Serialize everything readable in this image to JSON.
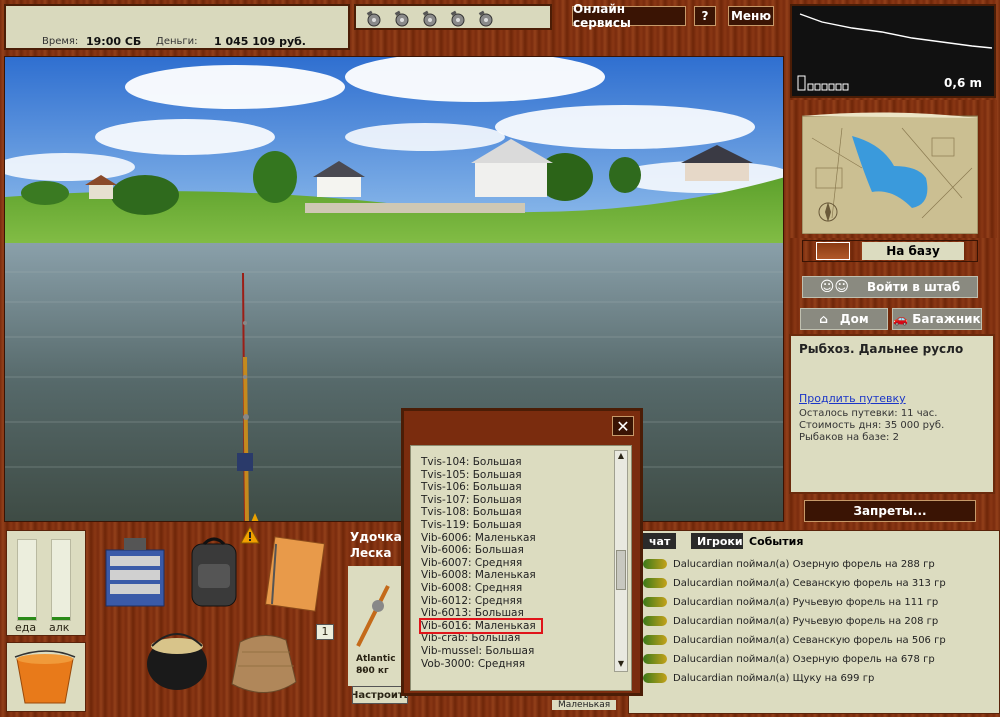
{
  "hud": {
    "time_label": "Время:",
    "time_value": "19:00 СБ",
    "money_label": "Деньги:",
    "money_value": "1 045 109 руб."
  },
  "menu": {
    "online_services": "Онлайн сервисы",
    "help": "?",
    "menu": "Меню"
  },
  "depth": {
    "value": "0,6 m"
  },
  "nav": {
    "to_base": "На базу",
    "hq": "Войти в штаб",
    "home": "Дом",
    "trunk": "Багажник",
    "bans": "Запреты..."
  },
  "base": {
    "title": "Рыбхоз. Дальнее русло",
    "extend_link": "Продлить путевку",
    "remaining": "Осталось путевки: 11 час.",
    "cost": "Стоимость дня: 35 000 руб.",
    "fishers": "Рыбаков на базе: 2"
  },
  "meters": {
    "food_label": "еда",
    "alc_label": "алк",
    "food_level": 0.04,
    "alc_level": 0.04
  },
  "inventory": {
    "slot_count": "1"
  },
  "rod": {
    "rod_label": "Удочка",
    "line_label": "Леска",
    "reel_name": "Atlantic ...",
    "reel_weight": "800 кг",
    "setup_button": "Настроить",
    "size_hint": "Маленькая"
  },
  "events": {
    "tabs": [
      "чат",
      "Игроки",
      "События"
    ],
    "active_tab": "События",
    "rows": [
      "Dalucardian поймал(а) Озерную форель на 288 гр",
      "Dalucardian поймал(а) Севанскую форель на 313 гр",
      "Dalucardian поймал(а) Ручьевую форель на 111 гр",
      "Dalucardian поймал(а) Ручьевую форель на 208 гр",
      "Dalucardian поймал(а) Севанскую форель на 506 гр",
      "Dalucardian поймал(а) Озерную форель на 678 гр",
      "Dalucardian поймал(а) Щуку на 699 гр"
    ]
  },
  "lure_list": {
    "close": "✕",
    "items": [
      "Tvis-104: Большая",
      "Tvis-105: Большая",
      "Tvis-106: Большая",
      "Tvis-107: Большая",
      "Tvis-108: Большая",
      "Tvis-119: Большая",
      "Vib-6006: Маленькая",
      "Vib-6006: Большая",
      "Vib-6007: Средняя",
      "Vib-6008: Маленькая",
      "Vib-6008: Средняя",
      "Vib-6012: Средняя",
      "Vib-6013: Большая",
      "Vib-6016: Маленькая",
      "Vib-crab: Большая",
      "Vib-mussel: Большая",
      "Vob-3000: Средняя"
    ],
    "highlighted_index": 13,
    "scroll_position": 0.55
  },
  "colors": {
    "wood": "#7a2c0e",
    "panel": "#dcdcc0",
    "link": "#1b36c7",
    "highlight": "#e0141a"
  }
}
